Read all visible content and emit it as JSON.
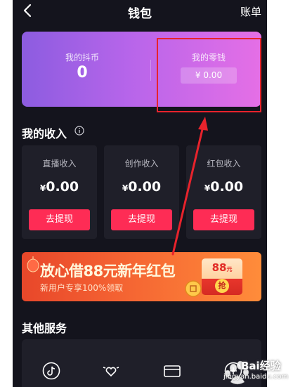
{
  "header": {
    "title": "钱包",
    "ledger_label": "账单"
  },
  "wallet": {
    "coins_label": "我的抖币",
    "coins_value": "0",
    "change_label": "我的零钱",
    "change_value": "¥ 0.00"
  },
  "income": {
    "title": "我的收入",
    "cards": [
      {
        "label": "直播收入",
        "currency": "¥",
        "value": "0.00",
        "button": "去提现"
      },
      {
        "label": "创作收入",
        "currency": "¥",
        "value": "0.00",
        "button": "去提现"
      },
      {
        "label": "红包收入",
        "currency": "¥",
        "value": "0.00",
        "button": "去提现"
      }
    ]
  },
  "banner": {
    "title": "放心借88元新年红包",
    "subtitle": "新用户专享100%领取",
    "packet_amount": "88",
    "packet_unit": "元",
    "packet_button": "抢"
  },
  "services": {
    "title": "其他服务",
    "icons": [
      "douyin-icon",
      "heart-wings-icon",
      "card-icon",
      "add-icon"
    ]
  },
  "watermark": {
    "brand": "Bai",
    "text": "经验",
    "url": "jingyan.baidu.com"
  },
  "colors": {
    "background": "#14141d",
    "card": "#1f1f29",
    "accent": "#fe2c55",
    "annotation": "#e8232c"
  }
}
